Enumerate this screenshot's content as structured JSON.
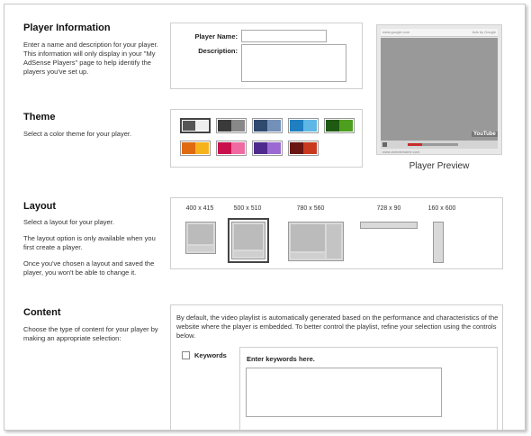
{
  "player_info": {
    "title": "Player Information",
    "description": "Enter a name and description for your player. This information will only display in your \"My AdSense Players\" page to help identify the players you've set up.",
    "name_label": "Player Name:",
    "name_value": "",
    "description_label": "Description:",
    "description_value": ""
  },
  "preview": {
    "caption": "Player Preview",
    "header_left": "www.google.com",
    "header_right": "Ads by Google",
    "brand": "YouTube",
    "footer_url": "www.domainname.com"
  },
  "theme": {
    "title": "Theme",
    "description": "Select a color theme for your player.",
    "swatches": [
      {
        "left": "#555555",
        "right": "#eeeeee",
        "selected": true
      },
      {
        "left": "#3a3a3a",
        "right": "#888888",
        "selected": false
      },
      {
        "left": "#2f4a6e",
        "right": "#7390b8",
        "selected": false
      },
      {
        "left": "#1f7fc1",
        "right": "#5fb7e6",
        "selected": false
      },
      {
        "left": "#1f5a12",
        "right": "#4e9e1f",
        "selected": false
      },
      {
        "left": "#e06a10",
        "right": "#f6b21a",
        "selected": false
      },
      {
        "left": "#c8104d",
        "right": "#ef6aa0",
        "selected": false
      },
      {
        "left": "#4e2a8e",
        "right": "#9a69d2",
        "selected": false
      },
      {
        "left": "#6a1414",
        "right": "#c9391e",
        "selected": false
      }
    ]
  },
  "layout": {
    "title": "Layout",
    "description_1": "Select a layout for your player.",
    "description_2": "The layout option is only available when you first create a player.",
    "description_3": "Once you've chosen a layout and saved the player, you won't be able to change it.",
    "options": [
      {
        "label": "400 x 415",
        "selected": false
      },
      {
        "label": "500 x 510",
        "selected": true
      },
      {
        "label": "780 x 560",
        "selected": false
      },
      {
        "label": "728 x 90",
        "selected": false
      },
      {
        "label": "160 x 600",
        "selected": false
      }
    ]
  },
  "content": {
    "title": "Content",
    "description": "Choose the type of content for your player by making an appropriate selection:",
    "intro": "By default, the video playlist is automatically generated based on the performance and characteristics of the website where the player is embedded. To better control the playlist, refine your selection using the controls below.",
    "keywords_label": "Keywords",
    "keywords_checked": false,
    "keywords_prompt": "Enter keywords here.",
    "keywords_value": ""
  }
}
